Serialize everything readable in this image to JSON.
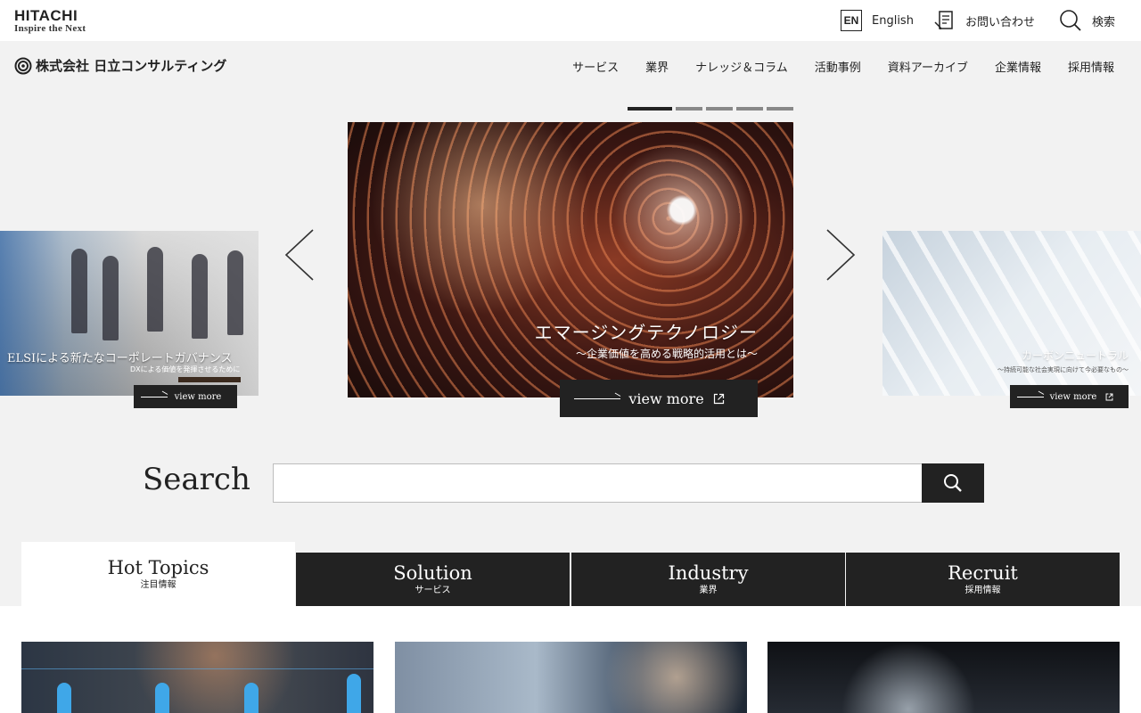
{
  "header": {
    "logo_name": "HITACHI",
    "logo_tagline": "Inspire the Next",
    "lang_badge": "EN",
    "lang_label": "English",
    "contact_label": "お問い合わせ",
    "search_label": "検索"
  },
  "nav": {
    "company_name": "株式会社 日立コンサルティング",
    "items": [
      "サービス",
      "業界",
      "ナレッジ＆コラム",
      "活動事例",
      "資料アーカイブ",
      "企業情報",
      "採用情報"
    ]
  },
  "carousel": {
    "total_slides": 5,
    "active_index": 0,
    "main": {
      "title": "エマージングテクノロジー",
      "subtitle": "～企業価値を高める戦略的活用とは～",
      "cta": "view more"
    },
    "prev": {
      "title": "ELSIによる新たなコーポレートガバナンス",
      "subtitle": "DXによる価値を発揮させるために",
      "cta": "view more"
    },
    "next": {
      "title": "カーボンニュートラル",
      "subtitle": "～持続可能な社会実現に向けて今必要なもの～",
      "cta": "view more"
    }
  },
  "search": {
    "label": "Search",
    "value": "",
    "placeholder": ""
  },
  "tabs": [
    {
      "en": "Hot Topics",
      "ja": "注目情報",
      "active": true
    },
    {
      "en": "Solution",
      "ja": "サービス",
      "active": false
    },
    {
      "en": "Industry",
      "ja": "業界",
      "active": false
    },
    {
      "en": "Recruit",
      "ja": "採用情報",
      "active": false
    }
  ],
  "colors": {
    "dark": "#222222",
    "background": "#f2f2f2",
    "white": "#ffffff"
  }
}
